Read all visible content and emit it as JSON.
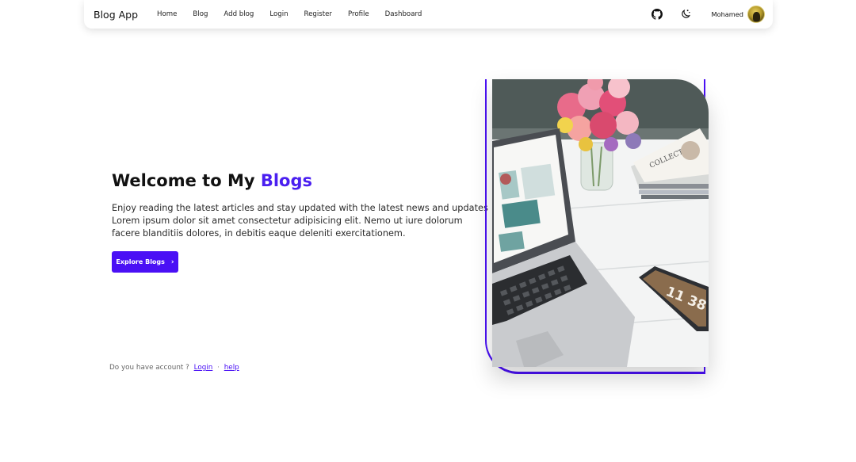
{
  "navbar": {
    "brand": "Blog App",
    "links": [
      "Home",
      "Blog",
      "Add blog",
      "Login",
      "Register",
      "Profile",
      "Dashboard"
    ],
    "icons": [
      "github-icon",
      "theme-toggle-icon"
    ],
    "user_name": "Mohamed"
  },
  "hero": {
    "title_prefix": "Welcome to My ",
    "title_accent": "Blogs",
    "text_lines": [
      "Enjoy reading the latest articles and stay updated with the latest news and updates",
      "Lorem ipsum dolor sit amet consectetur adipisicing elit. Nemo ut iure dolorum",
      "facere blanditiis dolores, in debitis eaque deleniti exercitationem."
    ],
    "button_label": "Explore Blogs",
    "button_icon": "chevron-right-icon"
  },
  "account": {
    "question": "Do you have account ?",
    "login_label": "Login",
    "separator": "·",
    "help_label": "help"
  },
  "image": {
    "phone_time": "11 38"
  },
  "colors": {
    "accent": "#4a10f5",
    "title_accent": "#4a1ff0"
  }
}
